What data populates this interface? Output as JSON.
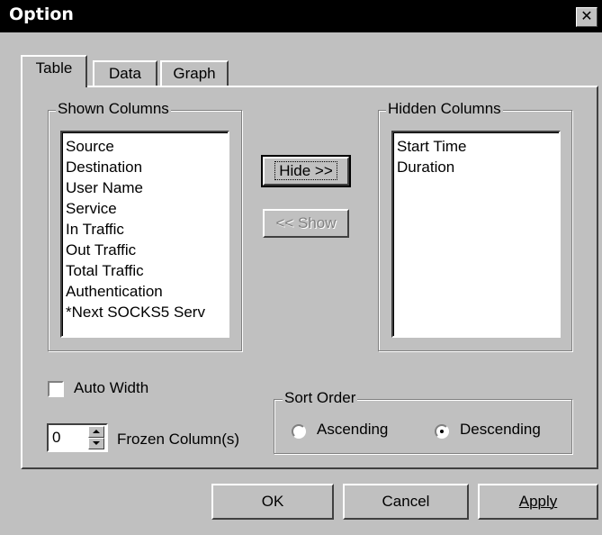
{
  "window": {
    "title": "Option",
    "close_glyph": "✕"
  },
  "tabs": [
    {
      "label": "Table",
      "active": true
    },
    {
      "label": "Data",
      "active": false
    },
    {
      "label": "Graph",
      "active": false
    }
  ],
  "shown_columns": {
    "title": "Shown Columns",
    "items": [
      "Source",
      "Destination",
      "User Name",
      "Service",
      "In Traffic",
      "Out Traffic",
      "Total Traffic",
      "Authentication",
      "*Next SOCKS5 Serv"
    ]
  },
  "hidden_columns": {
    "title": "Hidden Columns",
    "items": [
      "Start Time",
      "Duration"
    ]
  },
  "buttons": {
    "hide": "Hide >>",
    "show": "<< Show",
    "ok": "OK",
    "cancel": "Cancel",
    "apply": "Apply"
  },
  "auto_width": {
    "label": "Auto Width",
    "checked": false
  },
  "frozen": {
    "value": "0",
    "label": "Frozen Column(s)"
  },
  "sort_order": {
    "title": "Sort Order",
    "options": [
      {
        "label": "Ascending",
        "selected": false
      },
      {
        "label": "Descending",
        "selected": true
      }
    ]
  },
  "icons": {
    "close": "close-icon",
    "spin_up": "arrow-up-icon",
    "spin_down": "arrow-down-icon"
  }
}
